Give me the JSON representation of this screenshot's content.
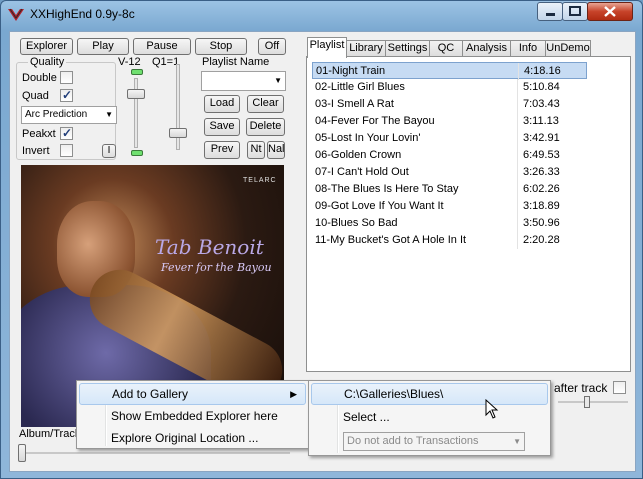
{
  "window": {
    "title": "XXHighEnd 0.9y-8c",
    "icon": "xxhighend-logo-icon"
  },
  "toolbar": {
    "explorer": "Explorer",
    "play": "Play",
    "pause": "Pause",
    "stop": "Stop",
    "off": "Off"
  },
  "quality": {
    "group_label": "Quality",
    "double_label": "Double",
    "double_checked": false,
    "quad_label": "Quad",
    "quad_checked": true,
    "filter_value": "Arc Prediction",
    "peakxt_label": "Peakxt",
    "peakxt_checked": true,
    "invert_label": "Invert",
    "invert_checked": false,
    "i_button": "I"
  },
  "sliders": {
    "v12_label": "V-12",
    "q1_label": "Q1=1"
  },
  "playlist_name": {
    "label": "Playlist Name",
    "value": "",
    "load": "Load",
    "clear": "Clear",
    "save": "Save",
    "delete": "Delete",
    "prev": "Prev",
    "nt": "Nt",
    "nal": "Nal"
  },
  "album": {
    "artist": "Tab Benoit",
    "title": "Fever for the Bayou",
    "label": "TELARC",
    "caption_prefix": "Album/Track"
  },
  "tabs": [
    {
      "label": "Playlist",
      "active": true
    },
    {
      "label": "Library",
      "active": false
    },
    {
      "label": "Settings",
      "active": false
    },
    {
      "label": "QC",
      "active": false
    },
    {
      "label": "Analysis",
      "active": false
    },
    {
      "label": "Info",
      "active": false
    },
    {
      "label": "UnDemo",
      "active": false
    }
  ],
  "tracks": [
    {
      "name": "01-Night Train",
      "duration": "4:18.16",
      "selected": true
    },
    {
      "name": "02-Little Girl Blues",
      "duration": "5:10.84",
      "selected": false
    },
    {
      "name": "03-I Smell A Rat",
      "duration": "7:03.43",
      "selected": false
    },
    {
      "name": "04-Fever For The Bayou",
      "duration": "3:11.13",
      "selected": false
    },
    {
      "name": "05-Lost In Your Lovin'",
      "duration": "3:42.91",
      "selected": false
    },
    {
      "name": "06-Golden Crown",
      "duration": "6:49.53",
      "selected": false
    },
    {
      "name": "07-I Can't Hold Out",
      "duration": "3:26.33",
      "selected": false
    },
    {
      "name": "08-The Blues Is Here To Stay",
      "duration": "6:02.26",
      "selected": false
    },
    {
      "name": "09-Got Love If You Want It",
      "duration": "3:18.89",
      "selected": false
    },
    {
      "name": "10-Blues So Bad",
      "duration": "3:50.96",
      "selected": false
    },
    {
      "name": "11-My Bucket's Got A Hole In It",
      "duration": "2:20.28",
      "selected": false
    }
  ],
  "after_track": {
    "label": "after track",
    "checked": false
  },
  "context_menu": {
    "add_to_gallery": "Add to Gallery",
    "show_embedded_explorer": "Show Embedded Explorer here",
    "explore_original_location": "Explore Original Location ..."
  },
  "gallery_submenu": {
    "path": "C:\\Galleries\\Blues\\",
    "select": "Select ...",
    "transactions_value": "Do not add to Transactions"
  },
  "colors": {
    "selection": "#c6dbf3",
    "titlebar": "#9cc3e4",
    "close_button": "#c7432a"
  }
}
